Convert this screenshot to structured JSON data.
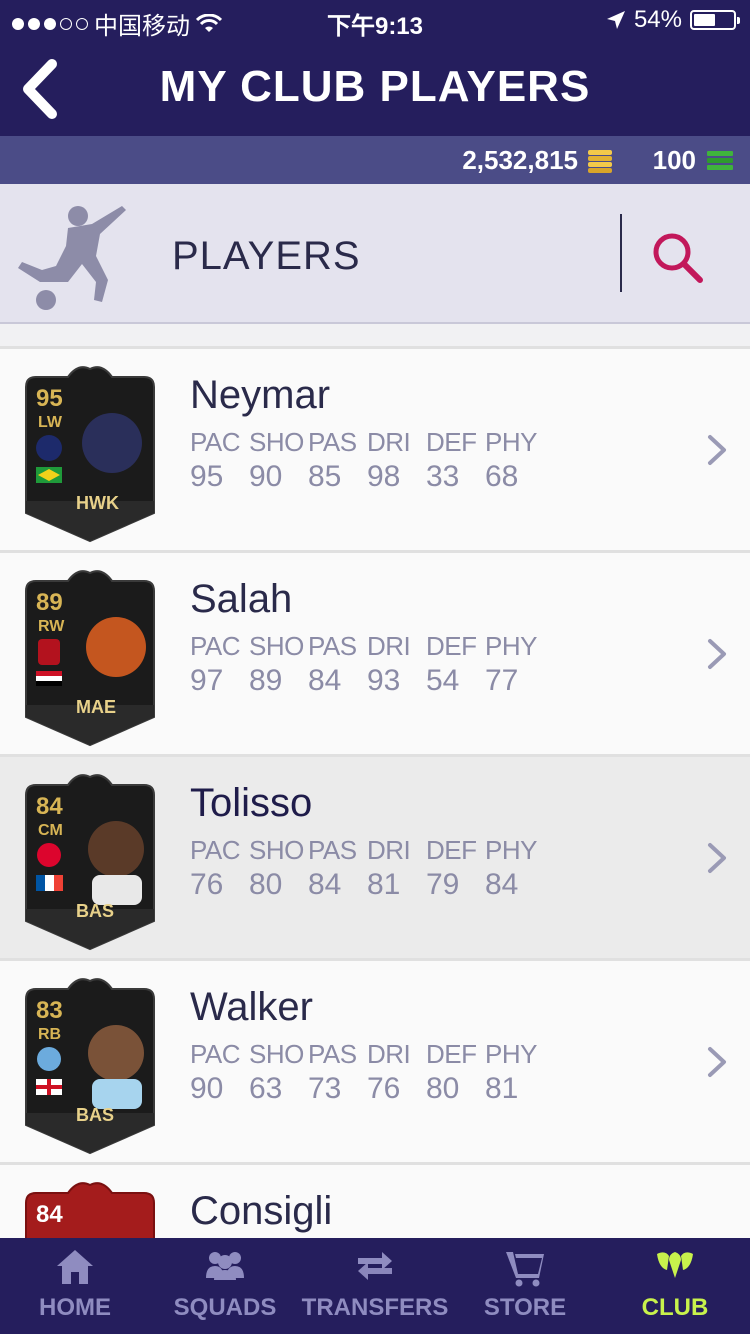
{
  "status_bar": {
    "carrier": "中国移动",
    "time": "下午9:13",
    "battery": "54%",
    "battery_level": 0.54
  },
  "header": {
    "title": "MY CLUB PLAYERS",
    "back_icon": "chevron-left-icon"
  },
  "currency": {
    "coins": "2,532,815",
    "points": "100"
  },
  "players_section": {
    "title": "PLAYERS",
    "search_icon": "search-icon"
  },
  "colors": {
    "accent": "#c8f24c",
    "header_bg": "#251e5d",
    "search_pink": "#c2185b",
    "card_gold": "#d8b555"
  },
  "stat_labels": [
    "PAC",
    "SHO",
    "PAS",
    "DRI",
    "DEF",
    "PHY"
  ],
  "players": [
    {
      "name": "Neymar",
      "rating": "95",
      "position": "LW",
      "chem_style": "HWK",
      "stats": [
        "95",
        "90",
        "85",
        "98",
        "33",
        "68"
      ],
      "club": "PSG",
      "nation": "Brazil"
    },
    {
      "name": "Salah",
      "rating": "89",
      "position": "RW",
      "chem_style": "MAE",
      "stats": [
        "97",
        "89",
        "84",
        "93",
        "54",
        "77"
      ],
      "club": "Liverpool",
      "nation": "Egypt"
    },
    {
      "name": "Tolisso",
      "rating": "84",
      "position": "CM",
      "chem_style": "BAS",
      "stats": [
        "76",
        "80",
        "84",
        "81",
        "79",
        "84"
      ],
      "club": "Bayern",
      "nation": "France"
    },
    {
      "name": "Walker",
      "rating": "83",
      "position": "RB",
      "chem_style": "BAS",
      "stats": [
        "90",
        "63",
        "73",
        "76",
        "80",
        "81"
      ],
      "club": "Man City",
      "nation": "England"
    },
    {
      "name": "Consigli",
      "rating": "84",
      "position": "",
      "chem_style": "",
      "stats": [],
      "club": "",
      "nation": ""
    }
  ],
  "bottom_nav": [
    {
      "label": "HOME",
      "icon": "home-icon"
    },
    {
      "label": "SQUADS",
      "icon": "squads-icon"
    },
    {
      "label": "TRANSFERS",
      "icon": "transfers-icon"
    },
    {
      "label": "STORE",
      "icon": "cart-icon"
    },
    {
      "label": "CLUB",
      "icon": "club-icon",
      "active": true
    }
  ]
}
